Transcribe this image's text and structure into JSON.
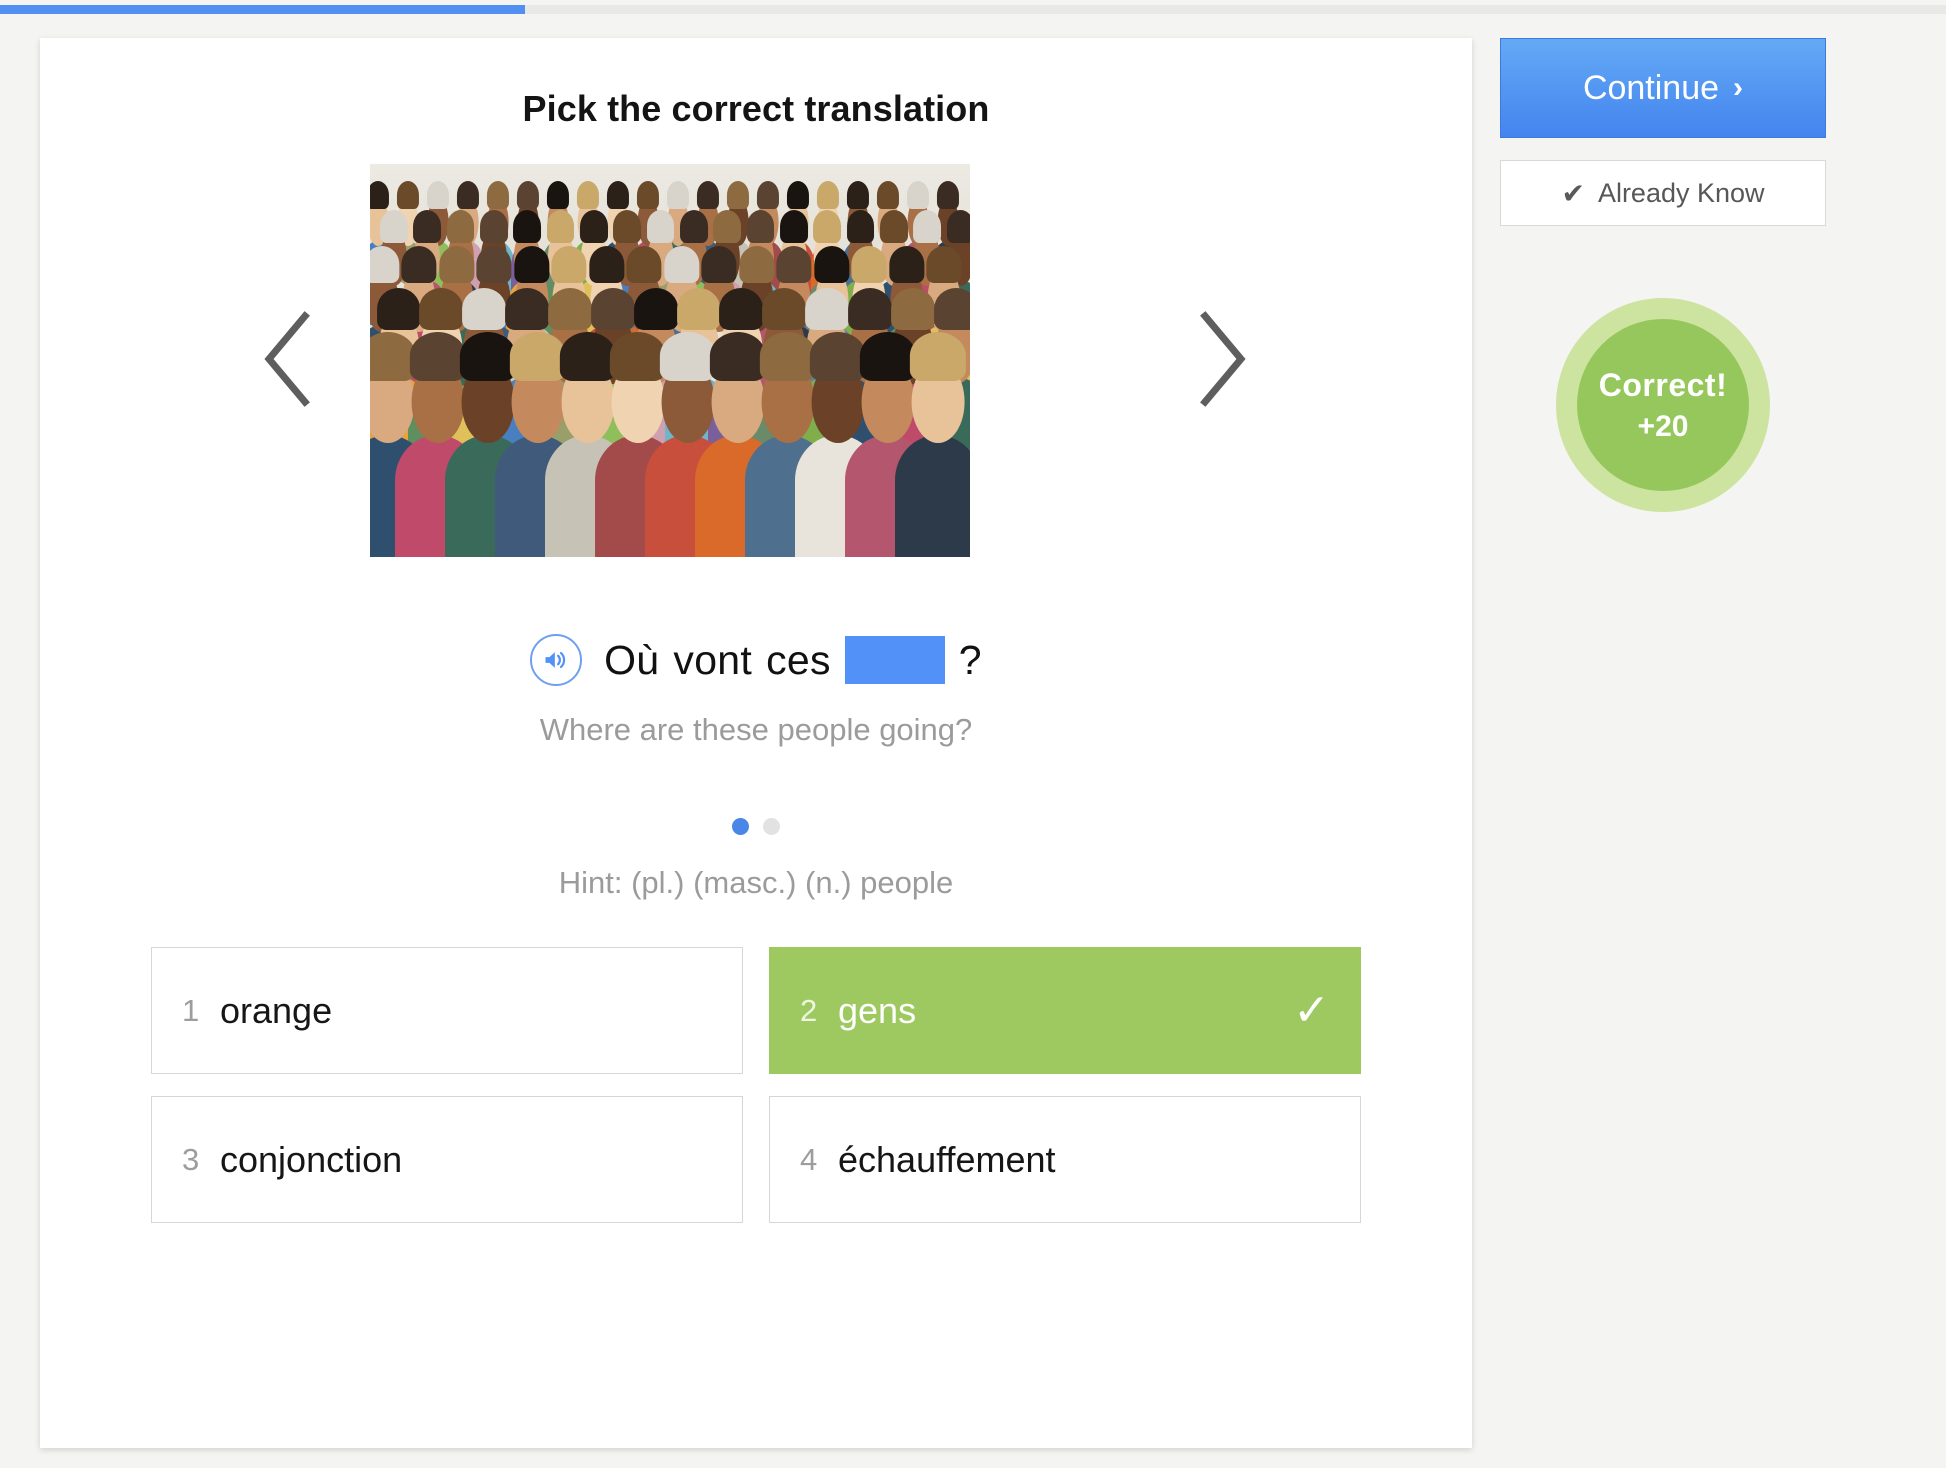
{
  "progress": {
    "percent": 27
  },
  "card": {
    "title": "Pick the correct translation",
    "carousel": {
      "prev_icon": "chevron-left-icon",
      "next_icon": "chevron-right-icon",
      "image_alt": "large diverse crowd of people"
    },
    "prompt": {
      "audio_icon": "speaker-icon",
      "words": [
        "Où",
        "vont",
        "ces"
      ],
      "blank": "",
      "punctuation": "?",
      "translation": "Where are these people going?"
    },
    "dots": {
      "count": 2,
      "active_index": 0
    },
    "hint": "Hint: (pl.) (masc.) (n.) people",
    "options": [
      {
        "num": "1",
        "label": "orange",
        "correct": false
      },
      {
        "num": "2",
        "label": "gens",
        "correct": true
      },
      {
        "num": "3",
        "label": "conjonction",
        "correct": false
      },
      {
        "num": "4",
        "label": "échauffement",
        "correct": false
      }
    ],
    "check_icon": "check-icon"
  },
  "rail": {
    "continue_label": "Continue",
    "continue_chevron": "chevron-right-icon",
    "already_know_label": "Already Know",
    "already_know_icon": "check-icon",
    "score": {
      "status": "Correct!",
      "points": "+20"
    }
  },
  "colors": {
    "accent_blue": "#5291f7",
    "progress_blue": "#518ff0",
    "correct_green": "#9dc960",
    "badge_outer_green": "#cde4a0",
    "badge_inner_green": "#96c75c",
    "muted_text": "#9b9b9b"
  }
}
